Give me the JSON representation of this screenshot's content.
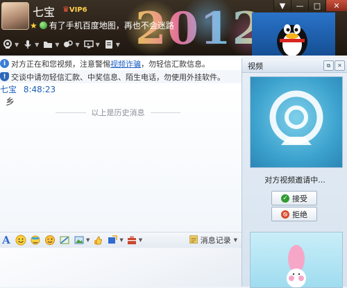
{
  "window": {
    "contact_name": "七宝",
    "vip_label": "VIP6",
    "status_message": "有了手机百度地图，再也不会迷路",
    "controls": {
      "menu": "▼",
      "minimize": "—",
      "maximize": "□",
      "close": "✕"
    }
  },
  "toolbar": {
    "items": [
      {
        "name": "video-call",
        "icon": "webcam-icon"
      },
      {
        "name": "voice-call",
        "icon": "microphone-icon"
      },
      {
        "name": "send-file",
        "icon": "folder-icon"
      },
      {
        "name": "remote-assist",
        "icon": "remote-icon"
      },
      {
        "name": "share-screen",
        "icon": "monitor-icon"
      },
      {
        "name": "apps",
        "icon": "apps-icon"
      }
    ]
  },
  "notices": {
    "line1_prefix": "对方正在和您视频，注意警惕",
    "line1_link": "视频诈骗",
    "line1_suffix": "，勿轻信汇款信息。",
    "line2": "交谈中请勿轻信汇款、中奖信息、陌生电话，勿使用外挂软件。"
  },
  "chat": {
    "sender": "七宝",
    "time": "8:48:23",
    "message": "乡",
    "history_label": "以上是历史消息"
  },
  "input_toolbar": {
    "history_button": "消息记录"
  },
  "video_panel": {
    "title": "视频",
    "invite_text": "对方视频邀请中...",
    "accept_label": "接受",
    "reject_label": "拒绝"
  },
  "colors": {
    "header_bg": "#2a2018",
    "link": "#1d5fc4",
    "chat_name": "#1b5fb9",
    "panel_bg": "#dfe8f2"
  }
}
